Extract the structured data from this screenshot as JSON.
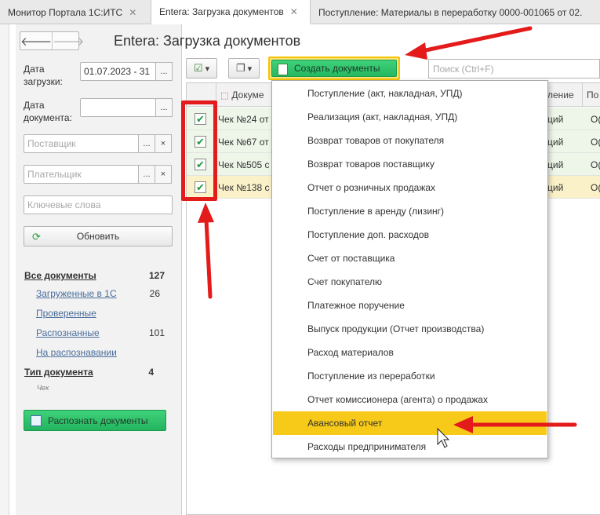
{
  "tabs": [
    {
      "label": "Монитор Портала 1С:ИТС",
      "closable": true,
      "active": false
    },
    {
      "label": "Entera: Загрузка документов",
      "closable": true,
      "active": true
    },
    {
      "label": "Поступление: Материалы в переработку 0000-001065 от 02.",
      "closable": false,
      "active": false
    }
  ],
  "page_title": "Entera: Загрузка документов",
  "filters": {
    "load_date_label": "Дата загрузки:",
    "load_date_value": "01.07.2023 - 31",
    "doc_date_label": "Дата документа:",
    "doc_date_value": "",
    "supplier_placeholder": "Поставщик",
    "payer_placeholder": "Плательщик",
    "keywords_placeholder": "Ключевые слова",
    "refresh_label": "Обновить",
    "more_btn": "...",
    "clear_btn": "×"
  },
  "stats": {
    "all_docs_label": "Все документы",
    "all_docs_count": "127",
    "loaded_label": "Загруженные в 1С",
    "loaded_count": "26",
    "checked_label": "Проверенные",
    "recognized_label": "Распознанные",
    "recognized_count": "101",
    "recognizing_label": "На распознавании",
    "doc_type_label": "Тип документа",
    "doc_type_count": "4",
    "doc_type_item": "Чек"
  },
  "recognize_button": "Распознать документы",
  "toolbar": {
    "create_label": "Создать документы",
    "search_placeholder": "Поиск (Ctrl+F)"
  },
  "grid": {
    "columns": [
      "Докуме",
      "ление",
      "По"
    ],
    "rows": [
      {
        "doc": "Чек №24 от",
        "col2": "ций",
        "col3": "О(",
        "checked": true
      },
      {
        "doc": "Чек №67 от",
        "col2": "ций",
        "col3": "О(",
        "checked": true
      },
      {
        "doc": "Чек №505 с",
        "col2": "ций",
        "col3": "О(",
        "checked": true
      },
      {
        "doc": "Чек №138 с",
        "col2": "ций",
        "col3": "О(",
        "checked": true
      }
    ]
  },
  "menu": {
    "items": [
      "Поступление (акт, накладная, УПД)",
      "Реализация (акт, накладная, УПД)",
      "Возврат товаров от покупателя",
      "Возврат товаров поставщику",
      "Отчет о розничных продажах",
      "Поступление в аренду (лизинг)",
      "Поступление доп. расходов",
      "Счет от поставщика",
      "Счет покупателю",
      "Платежное поручение",
      "Выпуск продукции (Отчет производства)",
      "Расход материалов",
      "Поступление из переработки",
      "Отчет комиссионера (агента) о продажах",
      "Авансовый отчет",
      "Расходы предпринимателя"
    ],
    "highlighted_index": 14
  },
  "colors": {
    "accent_green": "#25b860",
    "highlight_yellow": "#f7c918",
    "annotation_red": "#e41b1b"
  }
}
